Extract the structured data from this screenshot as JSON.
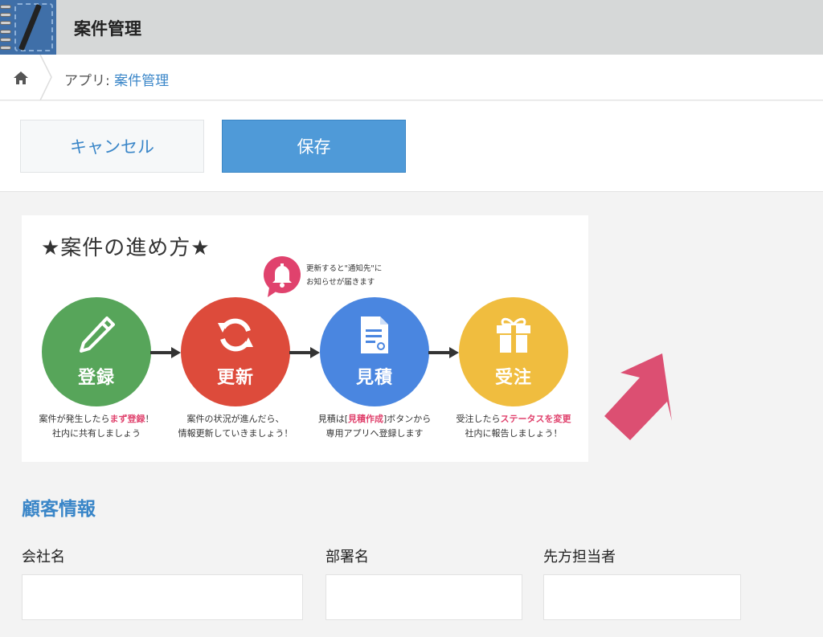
{
  "header": {
    "app_title": "案件管理",
    "app_icon": "notebook-pen-icon"
  },
  "breadcrumb": {
    "home_icon": "home-icon",
    "prefix": "アプリ: ",
    "app_link": "案件管理"
  },
  "toolbar": {
    "cancel_label": "キャンセル",
    "save_label": "保存"
  },
  "guide": {
    "title": "★案件の進め方★",
    "notify_line1": "更新すると\"通知先\"に",
    "notify_line2": "お知らせが届きます",
    "steps": [
      {
        "label": "登録",
        "color": "#57a55a",
        "icon": "pencil-icon",
        "line1_pre": "案件が発生したら",
        "line1_hl": "まず登録",
        "line1_post": "！",
        "line2": "社内に共有しましょう"
      },
      {
        "label": "更新",
        "color": "#dd4b3b",
        "icon": "refresh-icon",
        "line1_pre": "案件の状況が進んだら、",
        "line1_hl": "",
        "line1_post": "",
        "line2": "情報更新していきましょう！"
      },
      {
        "label": "見積",
        "color": "#4a86e0",
        "icon": "document-icon",
        "line1_pre": "見積は[",
        "line1_hl": "見積作成",
        "line1_post": "]ボタンから",
        "line2": "専用アプリへ登録します"
      },
      {
        "label": "受注",
        "color": "#f0bd3f",
        "icon": "gift-icon",
        "line1_pre": "受注したら",
        "line1_hl": "ステータスを変更",
        "line1_post": "",
        "line2": "社内に報告しましょう！"
      }
    ],
    "bell_color": "#e0426d"
  },
  "accent_arrow_color": "#dc4f72",
  "customer": {
    "section_title": "顧客情報",
    "fields": [
      {
        "label": "会社名",
        "value": ""
      },
      {
        "label": "部署名",
        "value": ""
      },
      {
        "label": "先方担当者",
        "value": ""
      }
    ]
  }
}
